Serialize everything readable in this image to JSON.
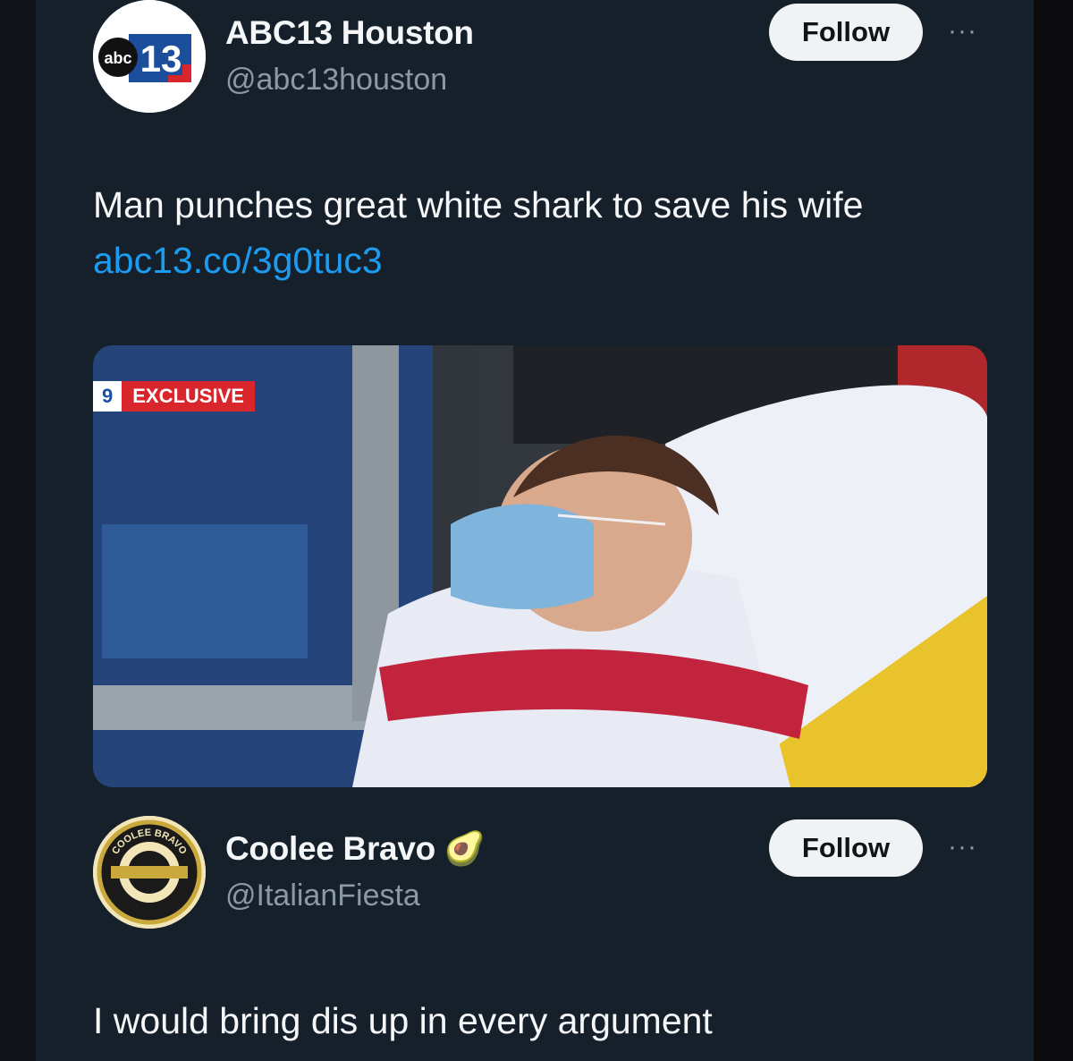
{
  "post": {
    "author_name": "ABC13 Houston",
    "author_handle": "@abc13houston",
    "avatar_text": "abc",
    "avatar_number": "13",
    "follow_label": "Follow",
    "more_label": "···",
    "text": "Man punches great white shark to save his wife",
    "link": "abc13.co/3g0tuc3",
    "media": {
      "channel_badge": "9",
      "exclusive_label": "EXCLUSIVE"
    }
  },
  "reply": {
    "author_name": "Coolee Bravo",
    "author_handle": "@ItalianFiesta",
    "avatar_ring_text": "COOLEE BRAVO",
    "emoji": "🥑",
    "follow_label": "Follow",
    "more_label": "···",
    "text": "I would bring dis up in every argument"
  },
  "colors": {
    "background": "#15202b",
    "link": "#1d9bf0",
    "follow_button": "#eff3f4"
  }
}
